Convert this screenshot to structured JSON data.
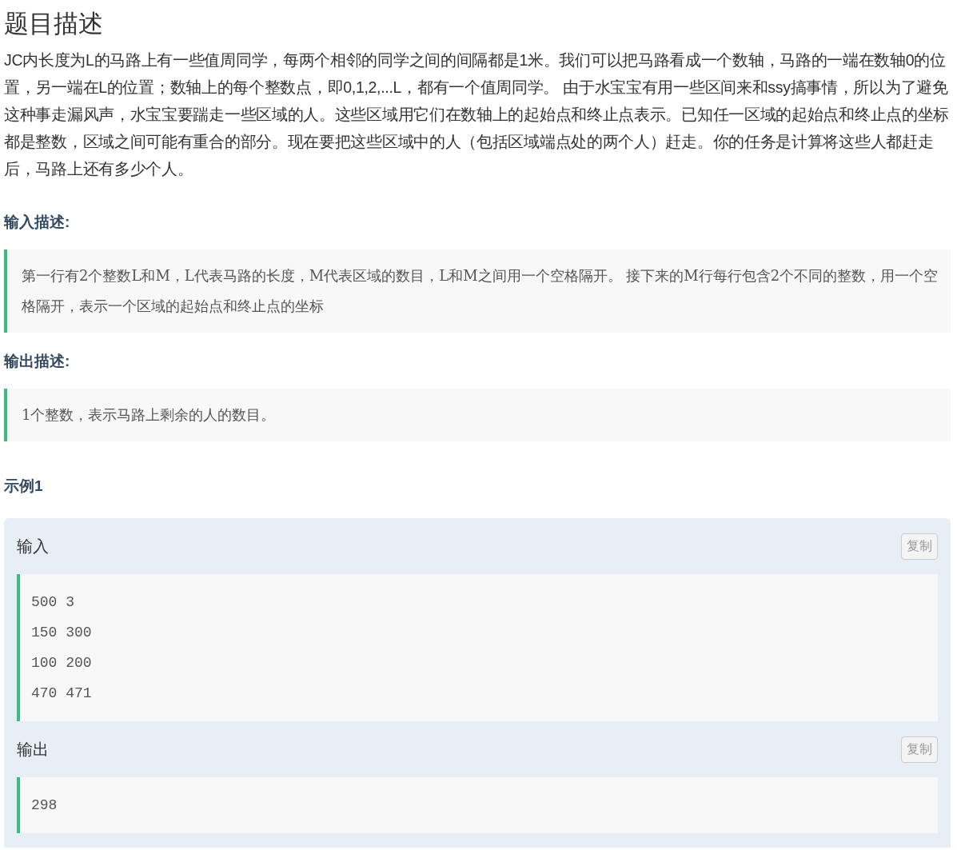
{
  "title": "题目描述",
  "description": "JC内长度为L的马路上有一些值周同学，每两个相邻的同学之间的间隔都是1米。我们可以把马路看成一个数轴，马路的一端在数轴0的位置，另一端在L的位置；数轴上的每个整数点，即0,1,2,...L，都有一个值周同学。 由于水宝宝有用一些区间来和ssy搞事情，所以为了避免这种事走漏风声，水宝宝要踹走一些区域的人。这些区域用它们在数轴上的起始点和终止点表示。已知任一区域的起始点和终止点的坐标都是整数，区域之间可能有重合的部分。现在要把这些区域中的人（包括区域端点处的两个人）赶走。你的任务是计算将这些人都赶走后，马路上还有多少个人。",
  "sections": [
    {
      "heading": "输入描述:",
      "body": "第一行有2个整数L和M，L代表马路的长度，M代表区域的数目，L和M之间用一个空格隔开。  接下来的M行每行包含2个不同的整数，用一个空格隔开，表示一个区域的起始点和终止点的坐标"
    },
    {
      "heading": "输出描述:",
      "body": "1个整数，表示马路上剩余的人的数目。"
    }
  ],
  "example": {
    "heading": "示例1",
    "blocks": [
      {
        "label": "输入",
        "copy": "复制",
        "lines": [
          "500 3",
          "150 300",
          "100 200",
          "470 471"
        ]
      },
      {
        "label": "输出",
        "copy": "复制",
        "lines": [
          "298"
        ]
      }
    ]
  }
}
